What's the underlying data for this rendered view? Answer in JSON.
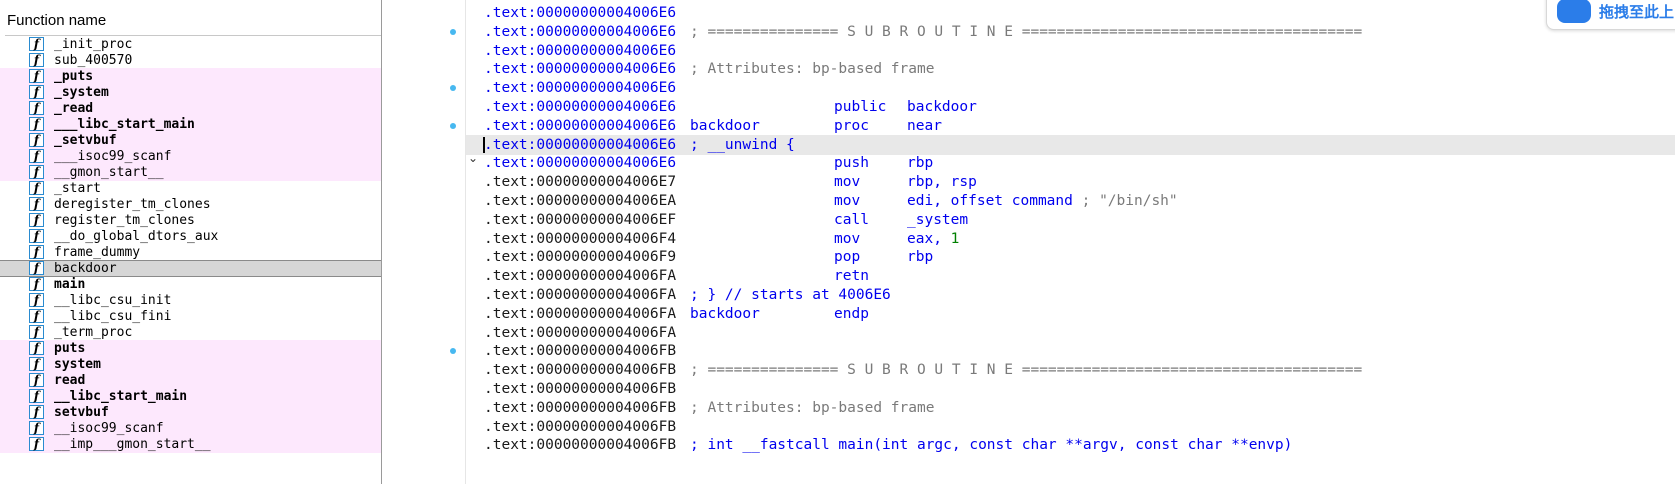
{
  "function_panel": {
    "header": "Function name",
    "functions": [
      {
        "name": "_init_proc",
        "style": "normal"
      },
      {
        "name": "sub_400570",
        "style": "normal"
      },
      {
        "name": "_puts",
        "style": "import-bold"
      },
      {
        "name": "_system",
        "style": "import-bold"
      },
      {
        "name": "_read",
        "style": "import-bold"
      },
      {
        "name": "___libc_start_main",
        "style": "import-bold"
      },
      {
        "name": "_setvbuf",
        "style": "import-bold"
      },
      {
        "name": "___isoc99_scanf",
        "style": "import"
      },
      {
        "name": "__gmon_start__",
        "style": "import"
      },
      {
        "name": "_start",
        "style": "normal"
      },
      {
        "name": "deregister_tm_clones",
        "style": "normal"
      },
      {
        "name": "register_tm_clones",
        "style": "normal"
      },
      {
        "name": "__do_global_dtors_aux",
        "style": "normal"
      },
      {
        "name": "frame_dummy",
        "style": "normal"
      },
      {
        "name": "backdoor",
        "style": "selected"
      },
      {
        "name": "main",
        "style": "bold"
      },
      {
        "name": "__libc_csu_init",
        "style": "normal"
      },
      {
        "name": "__libc_csu_fini",
        "style": "normal"
      },
      {
        "name": "_term_proc",
        "style": "normal"
      },
      {
        "name": "puts",
        "style": "import-bold"
      },
      {
        "name": "system",
        "style": "import-bold"
      },
      {
        "name": "read",
        "style": "import-bold"
      },
      {
        "name": "__libc_start_main",
        "style": "import-bold"
      },
      {
        "name": "setvbuf",
        "style": "import-bold"
      },
      {
        "name": "__isoc99_scanf",
        "style": "import"
      },
      {
        "name": "__imp___gmon_start__",
        "style": "import"
      }
    ]
  },
  "disassembly": {
    "lines": [
      {
        "addr": ".text:00000000004006E6",
        "blue": true
      },
      {
        "addr": ".text:00000000004006E6",
        "blue": true,
        "comment": "; =============== S U B R O U T I N E ======================================="
      },
      {
        "addr": ".text:00000000004006E6",
        "blue": true
      },
      {
        "addr": ".text:00000000004006E6",
        "blue": true,
        "comment": "; Attributes: bp-based frame"
      },
      {
        "addr": ".text:00000000004006E6",
        "blue": true
      },
      {
        "addr": ".text:00000000004006E6",
        "blue": true,
        "mnem": "public",
        "ops": "backdoor"
      },
      {
        "addr": ".text:00000000004006E6",
        "blue": true,
        "label": "backdoor",
        "mnem": "proc",
        "ops": "near"
      },
      {
        "addr": ".text:00000000004006E6",
        "blue": true,
        "current": true,
        "comment_blue": "; __unwind {"
      },
      {
        "addr": ".text:00000000004006E6",
        "blue": true,
        "mnem": "push",
        "ops": "rbp"
      },
      {
        "addr": ".text:00000000004006E7",
        "mnem": "mov",
        "ops": "rbp, rsp"
      },
      {
        "addr": ".text:00000000004006EA",
        "mnem": "mov",
        "ops": "edi, offset command",
        "ops_comment": " ; \"/bin/sh\""
      },
      {
        "addr": ".text:00000000004006EF",
        "mnem": "call",
        "ops": "_system"
      },
      {
        "addr": ".text:00000000004006F4",
        "mnem": "mov",
        "ops": "eax, ",
        "ops_num": "1"
      },
      {
        "addr": ".text:00000000004006F9",
        "mnem": "pop",
        "ops": "rbp"
      },
      {
        "addr": ".text:00000000004006FA",
        "mnem": "retn"
      },
      {
        "addr": ".text:00000000004006FA",
        "comment_blue": "; } // starts at 4006E6"
      },
      {
        "addr": ".text:00000000004006FA",
        "label": "backdoor",
        "mnem": "endp"
      },
      {
        "addr": ".text:00000000004006FA"
      },
      {
        "addr": ".text:00000000004006FB"
      },
      {
        "addr": ".text:00000000004006FB",
        "comment": "; =============== S U B R O U T I N E ======================================="
      },
      {
        "addr": ".text:00000000004006FB"
      },
      {
        "addr": ".text:00000000004006FB",
        "comment": "; Attributes: bp-based frame"
      },
      {
        "addr": ".text:00000000004006FB"
      },
      {
        "addr": ".text:00000000004006FB",
        "comment_blue": "; int __fastcall main(int argc, const char **argv, const char **envp)"
      }
    ]
  },
  "overlay": {
    "drag_widget_text": "拖拽至此上",
    "icon": "cloud-link-icon"
  },
  "colors": {
    "import_bg": "#fde8fd",
    "selected_bg": "#d6d6d6",
    "code_blue": "#0000ee",
    "comment_grey": "#7a7a7a",
    "number_green": "#008000",
    "breakpoint_dot": "#47b8f0"
  }
}
